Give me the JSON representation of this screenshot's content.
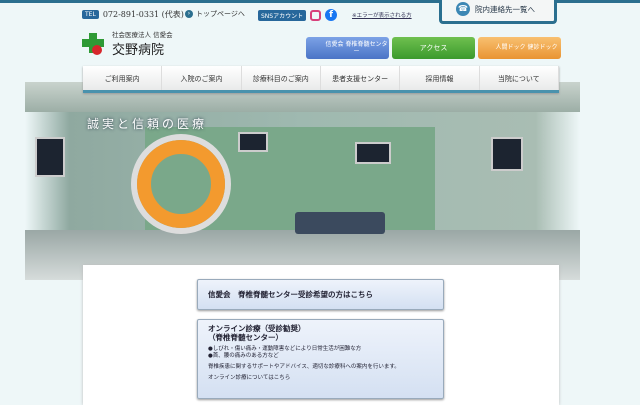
{
  "header": {
    "tel_tag": "TEL",
    "tel": "072-891-0331 (代表)",
    "top_link": "トップページへ",
    "sns_tag": "SNSアカウント",
    "error_link": "※エラーが表示される方",
    "contact": "院内連絡先一覧へ",
    "logo_sub": "社会医療法人 信愛会",
    "logo_main": "交野病院"
  },
  "banners": [
    "信愛会 脊椎脊髄センター",
    "アクセス",
    "人間ドック 健診ドック"
  ],
  "nav": [
    "ご利用案内",
    "入院のご案内",
    "診療科目のご案内",
    "患者支援センター",
    "採用情報",
    "当院について"
  ],
  "hero": {
    "motto": "誠実と信頼の医療"
  },
  "main": {
    "box1": "信愛会　脊椎脊髄センター受診希望の方はこちら",
    "box2": {
      "title1": "オンライン診療（受診勧奨）",
      "title2": "（脊椎脊髄センター）",
      "b1": "●しびれ・傷い痛み・運動障害などにより日常生活が困難な方",
      "b2": "●首、腰の痛みのある方など",
      "desc": "脊椎疾患に関するサポートやアドバイス、適切な診療科への案内を行います。",
      "link": "オンライン診療についてはこちら"
    }
  }
}
